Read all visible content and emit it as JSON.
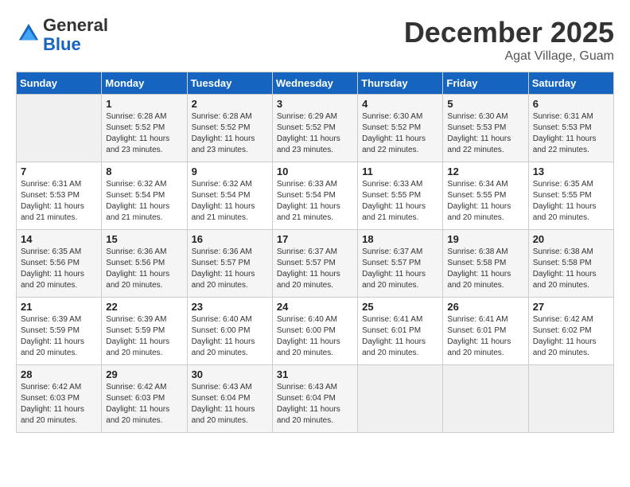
{
  "header": {
    "logo_general": "General",
    "logo_blue": "Blue",
    "month": "December 2025",
    "location": "Agat Village, Guam"
  },
  "weekdays": [
    "Sunday",
    "Monday",
    "Tuesday",
    "Wednesday",
    "Thursday",
    "Friday",
    "Saturday"
  ],
  "weeks": [
    [
      {
        "day": "",
        "info": ""
      },
      {
        "day": "1",
        "info": "Sunrise: 6:28 AM\nSunset: 5:52 PM\nDaylight: 11 hours\nand 23 minutes."
      },
      {
        "day": "2",
        "info": "Sunrise: 6:28 AM\nSunset: 5:52 PM\nDaylight: 11 hours\nand 23 minutes."
      },
      {
        "day": "3",
        "info": "Sunrise: 6:29 AM\nSunset: 5:52 PM\nDaylight: 11 hours\nand 23 minutes."
      },
      {
        "day": "4",
        "info": "Sunrise: 6:30 AM\nSunset: 5:52 PM\nDaylight: 11 hours\nand 22 minutes."
      },
      {
        "day": "5",
        "info": "Sunrise: 6:30 AM\nSunset: 5:53 PM\nDaylight: 11 hours\nand 22 minutes."
      },
      {
        "day": "6",
        "info": "Sunrise: 6:31 AM\nSunset: 5:53 PM\nDaylight: 11 hours\nand 22 minutes."
      }
    ],
    [
      {
        "day": "7",
        "info": "Sunrise: 6:31 AM\nSunset: 5:53 PM\nDaylight: 11 hours\nand 21 minutes."
      },
      {
        "day": "8",
        "info": "Sunrise: 6:32 AM\nSunset: 5:54 PM\nDaylight: 11 hours\nand 21 minutes."
      },
      {
        "day": "9",
        "info": "Sunrise: 6:32 AM\nSunset: 5:54 PM\nDaylight: 11 hours\nand 21 minutes."
      },
      {
        "day": "10",
        "info": "Sunrise: 6:33 AM\nSunset: 5:54 PM\nDaylight: 11 hours\nand 21 minutes."
      },
      {
        "day": "11",
        "info": "Sunrise: 6:33 AM\nSunset: 5:55 PM\nDaylight: 11 hours\nand 21 minutes."
      },
      {
        "day": "12",
        "info": "Sunrise: 6:34 AM\nSunset: 5:55 PM\nDaylight: 11 hours\nand 20 minutes."
      },
      {
        "day": "13",
        "info": "Sunrise: 6:35 AM\nSunset: 5:55 PM\nDaylight: 11 hours\nand 20 minutes."
      }
    ],
    [
      {
        "day": "14",
        "info": "Sunrise: 6:35 AM\nSunset: 5:56 PM\nDaylight: 11 hours\nand 20 minutes."
      },
      {
        "day": "15",
        "info": "Sunrise: 6:36 AM\nSunset: 5:56 PM\nDaylight: 11 hours\nand 20 minutes."
      },
      {
        "day": "16",
        "info": "Sunrise: 6:36 AM\nSunset: 5:57 PM\nDaylight: 11 hours\nand 20 minutes."
      },
      {
        "day": "17",
        "info": "Sunrise: 6:37 AM\nSunset: 5:57 PM\nDaylight: 11 hours\nand 20 minutes."
      },
      {
        "day": "18",
        "info": "Sunrise: 6:37 AM\nSunset: 5:57 PM\nDaylight: 11 hours\nand 20 minutes."
      },
      {
        "day": "19",
        "info": "Sunrise: 6:38 AM\nSunset: 5:58 PM\nDaylight: 11 hours\nand 20 minutes."
      },
      {
        "day": "20",
        "info": "Sunrise: 6:38 AM\nSunset: 5:58 PM\nDaylight: 11 hours\nand 20 minutes."
      }
    ],
    [
      {
        "day": "21",
        "info": "Sunrise: 6:39 AM\nSunset: 5:59 PM\nDaylight: 11 hours\nand 20 minutes."
      },
      {
        "day": "22",
        "info": "Sunrise: 6:39 AM\nSunset: 5:59 PM\nDaylight: 11 hours\nand 20 minutes."
      },
      {
        "day": "23",
        "info": "Sunrise: 6:40 AM\nSunset: 6:00 PM\nDaylight: 11 hours\nand 20 minutes."
      },
      {
        "day": "24",
        "info": "Sunrise: 6:40 AM\nSunset: 6:00 PM\nDaylight: 11 hours\nand 20 minutes."
      },
      {
        "day": "25",
        "info": "Sunrise: 6:41 AM\nSunset: 6:01 PM\nDaylight: 11 hours\nand 20 minutes."
      },
      {
        "day": "26",
        "info": "Sunrise: 6:41 AM\nSunset: 6:01 PM\nDaylight: 11 hours\nand 20 minutes."
      },
      {
        "day": "27",
        "info": "Sunrise: 6:42 AM\nSunset: 6:02 PM\nDaylight: 11 hours\nand 20 minutes."
      }
    ],
    [
      {
        "day": "28",
        "info": "Sunrise: 6:42 AM\nSunset: 6:03 PM\nDaylight: 11 hours\nand 20 minutes."
      },
      {
        "day": "29",
        "info": "Sunrise: 6:42 AM\nSunset: 6:03 PM\nDaylight: 11 hours\nand 20 minutes."
      },
      {
        "day": "30",
        "info": "Sunrise: 6:43 AM\nSunset: 6:04 PM\nDaylight: 11 hours\nand 20 minutes."
      },
      {
        "day": "31",
        "info": "Sunrise: 6:43 AM\nSunset: 6:04 PM\nDaylight: 11 hours\nand 20 minutes."
      },
      {
        "day": "",
        "info": ""
      },
      {
        "day": "",
        "info": ""
      },
      {
        "day": "",
        "info": ""
      }
    ]
  ]
}
